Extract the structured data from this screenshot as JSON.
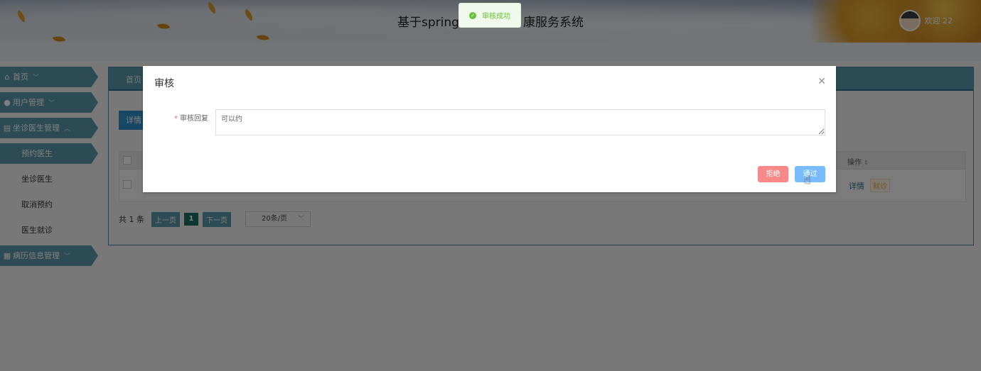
{
  "header": {
    "title": "基于spring",
    "title_rest": "康服务系统",
    "welcome": "欢迎 22"
  },
  "toast": {
    "message": "审核成功"
  },
  "sidebar": {
    "items": [
      {
        "label": "首页",
        "icon": "home-icon"
      },
      {
        "label": "用户管理",
        "icon": "user-icon"
      },
      {
        "label": "坐诊医生管理",
        "icon": "calendar-icon"
      },
      {
        "label": "预约医生"
      },
      {
        "label": "坐诊医生"
      },
      {
        "label": "取消预约"
      },
      {
        "label": "医生就诊"
      },
      {
        "label": "病历信息管理",
        "icon": "record-icon"
      }
    ]
  },
  "main": {
    "breadcrumb": "首页",
    "detail_button": "详情",
    "table": {
      "operation_header": "操作",
      "row_detail": "详情",
      "row_visit": "就诊"
    },
    "pagination": {
      "total": "共 1 条",
      "prev": "上一页",
      "page": "1",
      "next": "下一页",
      "page_size": "20条/页"
    }
  },
  "dialog": {
    "title": "审核",
    "close_icon": "close-icon",
    "field_label": "审核回复",
    "field_value": "可以约",
    "reject_label": "拒绝",
    "pass_label": "通过"
  },
  "colors": {
    "sidebar_accent": "#5b97a8",
    "reject": "#f78989",
    "pass": "#79bbff",
    "success": "#67c23a"
  }
}
